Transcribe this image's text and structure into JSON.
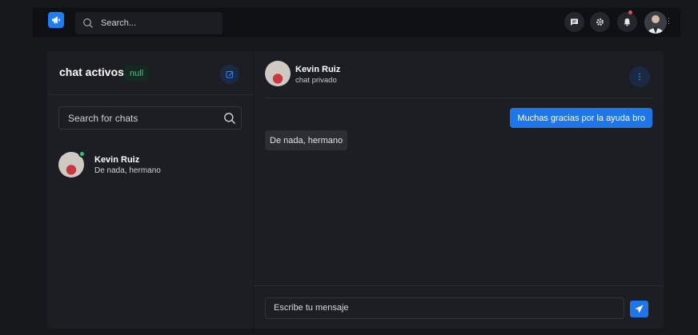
{
  "colors": {
    "accent": "#1f76e9",
    "online": "#2ac770",
    "badge_green": "#2fcf86",
    "notification": "#e34b58",
    "page_bg": "#16171b",
    "panel_bg": "#1d1e23"
  },
  "topbar": {
    "logo_icon": "megaphone-icon",
    "search_placeholder": "Search...",
    "icons": [
      "chat-icon",
      "gear-icon",
      "bell-icon"
    ],
    "avatar": "user-avatar"
  },
  "sidebar": {
    "title": "chat activos",
    "count_badge": "null",
    "compose_icon": "edit-icon",
    "search_placeholder": "Search for chats",
    "chats": [
      {
        "name": "Kevin Ruiz",
        "preview": "De nada, hermano",
        "online": true
      }
    ]
  },
  "conversation": {
    "contact_name": "Kevin Ruiz",
    "contact_subtitle": "chat privado",
    "more_icon": "more-vertical-icon",
    "messages": [
      {
        "direction": "outgoing",
        "text": "Muchas gracias por la ayuda bro"
      },
      {
        "direction": "incoming",
        "text": "De nada, hermano"
      }
    ],
    "composer_placeholder": "Escribe tu mensaje",
    "send_icon": "send-icon"
  }
}
